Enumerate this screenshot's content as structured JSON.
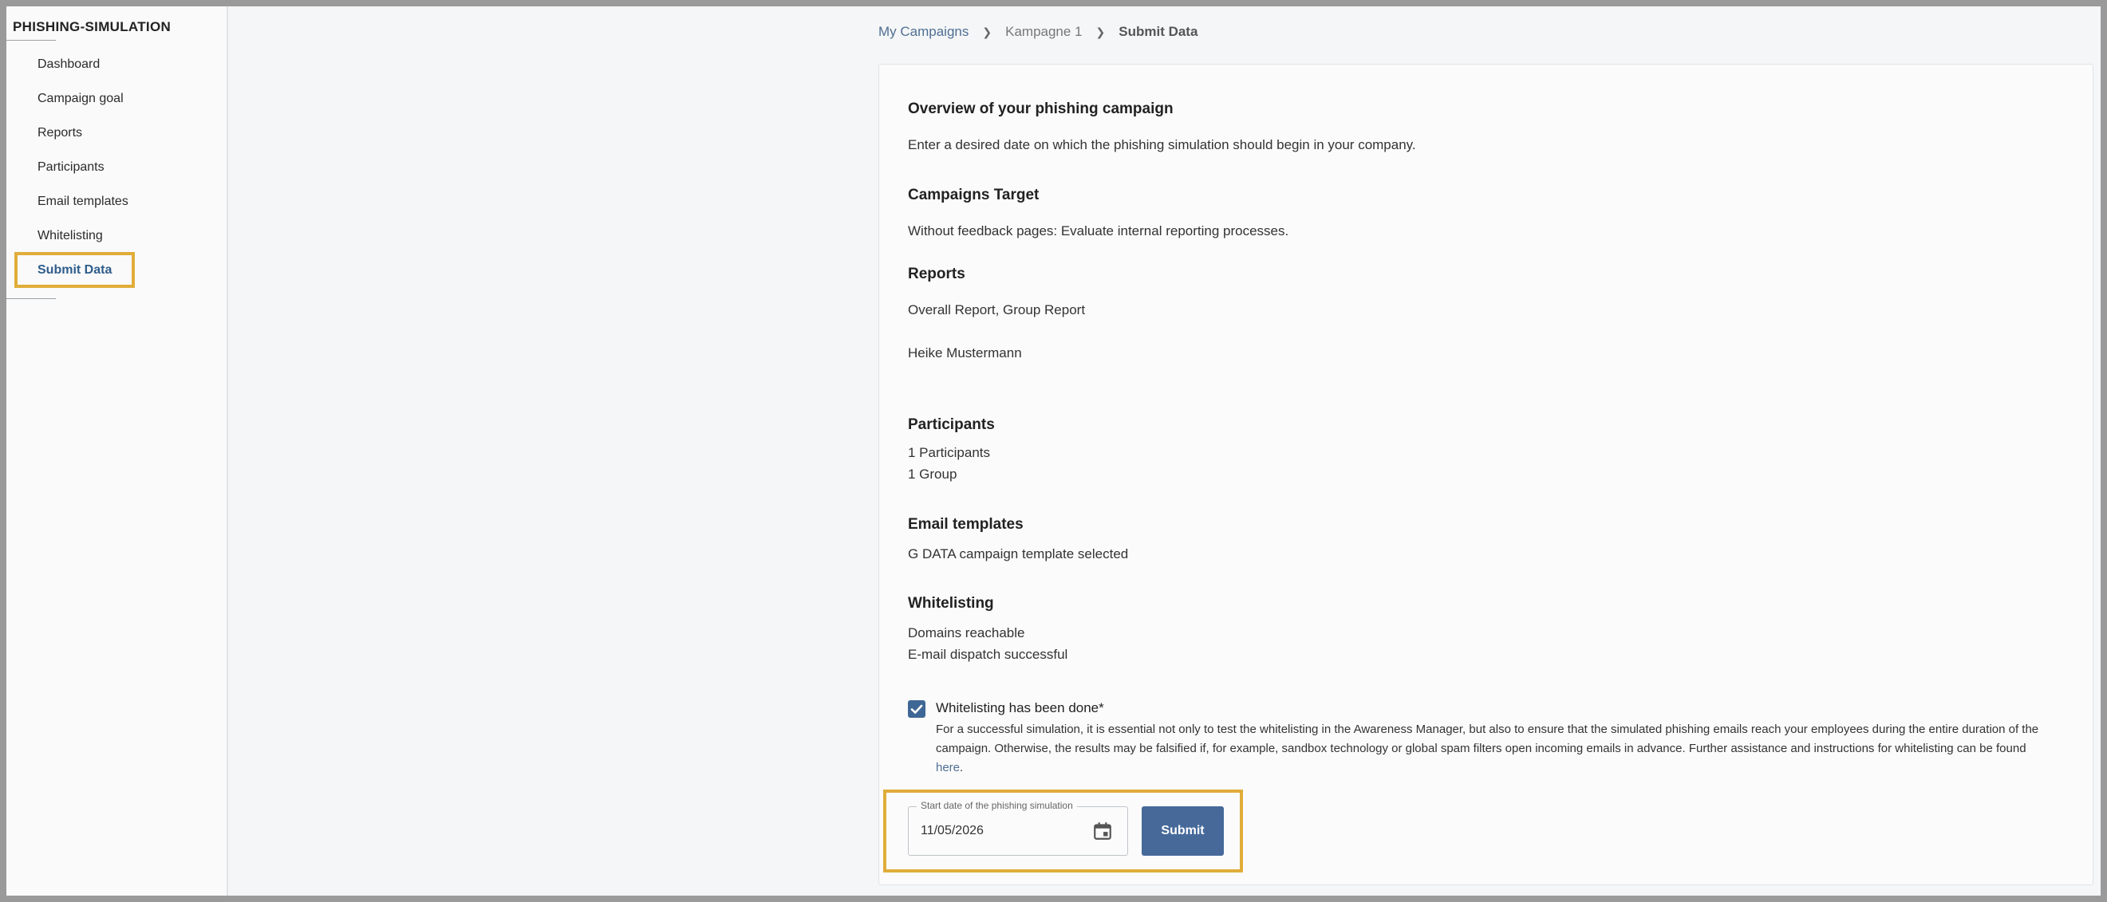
{
  "sidebar": {
    "brand": "PHISHING-SIMULATION",
    "items": [
      {
        "label": "Dashboard"
      },
      {
        "label": "Campaign goal"
      },
      {
        "label": "Reports"
      },
      {
        "label": "Participants"
      },
      {
        "label": "Email templates"
      },
      {
        "label": "Whitelisting"
      },
      {
        "label": "Submit Data",
        "active": true
      }
    ]
  },
  "breadcrumb": [
    "My Campaigns",
    "Kampagne 1",
    "Submit Data"
  ],
  "overview": {
    "title": "Overview of your phishing campaign",
    "intro": "Enter a desired date on which the phishing simulation should begin in your company."
  },
  "target": {
    "title": "Campaigns Target",
    "text": "Without feedback pages: Evaluate internal reporting processes."
  },
  "reports": {
    "title": "Reports",
    "text": "Overall Report, Group Report",
    "recipient": "Heike Mustermann"
  },
  "participants": {
    "title": "Participants",
    "lines": [
      "1 Participants",
      "1 Group"
    ]
  },
  "email_templates": {
    "title": "Email templates",
    "text": "G DATA campaign template selected"
  },
  "whitelisting": {
    "title": "Whitelisting",
    "lines": [
      "Domains reachable",
      "E-mail dispatch successful"
    ],
    "checkbox_label": "Whitelisting has been done*",
    "checked": true,
    "description": "For a successful simulation, it is essential not only to test the whitelisting in the Awareness Manager, but also to ensure that the simulated phishing emails reach your employees during the entire duration of the campaign. Otherwise, the results may be falsified if, for example, sandbox technology or global spam filters open incoming emails in advance. Further assistance and instructions for whitelisting can be found ",
    "link_text": "here",
    "suffix": "."
  },
  "start_date": {
    "label": "Start date of the phishing simulation",
    "value": "11/05/2026",
    "icon": "calendar-icon"
  },
  "submit_label": "Submit",
  "colors": {
    "accent": "#46699a",
    "highlight": "#e0ad3a",
    "link": "#4f6f94"
  }
}
